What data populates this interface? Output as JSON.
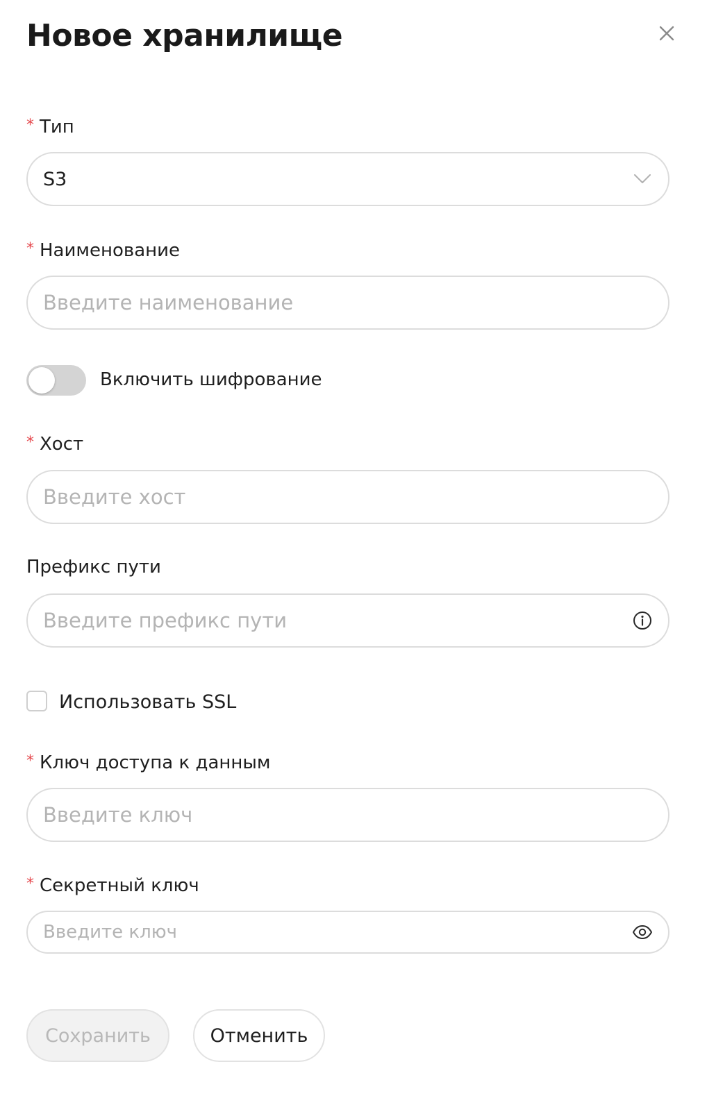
{
  "dialog": {
    "title": "Новое хранилище"
  },
  "form": {
    "type": {
      "label": "Тип",
      "value": "S3"
    },
    "name": {
      "label": "Наименование",
      "placeholder": "Введите наименование"
    },
    "encryption": {
      "label": "Включить шифрование",
      "enabled": false
    },
    "host": {
      "label": "Хост",
      "placeholder": "Введите хост"
    },
    "path_prefix": {
      "label": "Префикс пути",
      "placeholder": "Введите префикс пути"
    },
    "ssl": {
      "label": "Использовать SSL",
      "checked": false
    },
    "access_key": {
      "label": "Ключ доступа к данным",
      "placeholder": "Введите ключ"
    },
    "secret_key": {
      "label": "Секретный ключ",
      "placeholder": "Введите ключ"
    }
  },
  "actions": {
    "save_label": "Сохранить",
    "cancel_label": "Отменить"
  },
  "colors": {
    "required_marker": "#e5484d",
    "border": "#dcdcdc",
    "placeholder": "#b4b4b4",
    "toggle_off": "#d4d4d4",
    "disabled_button_bg": "#f2f2f2"
  },
  "icons": {
    "close": "close-icon",
    "select": "chevron-down-icon",
    "prefix_info": "info-icon",
    "secret_visibility": "eye-icon"
  }
}
